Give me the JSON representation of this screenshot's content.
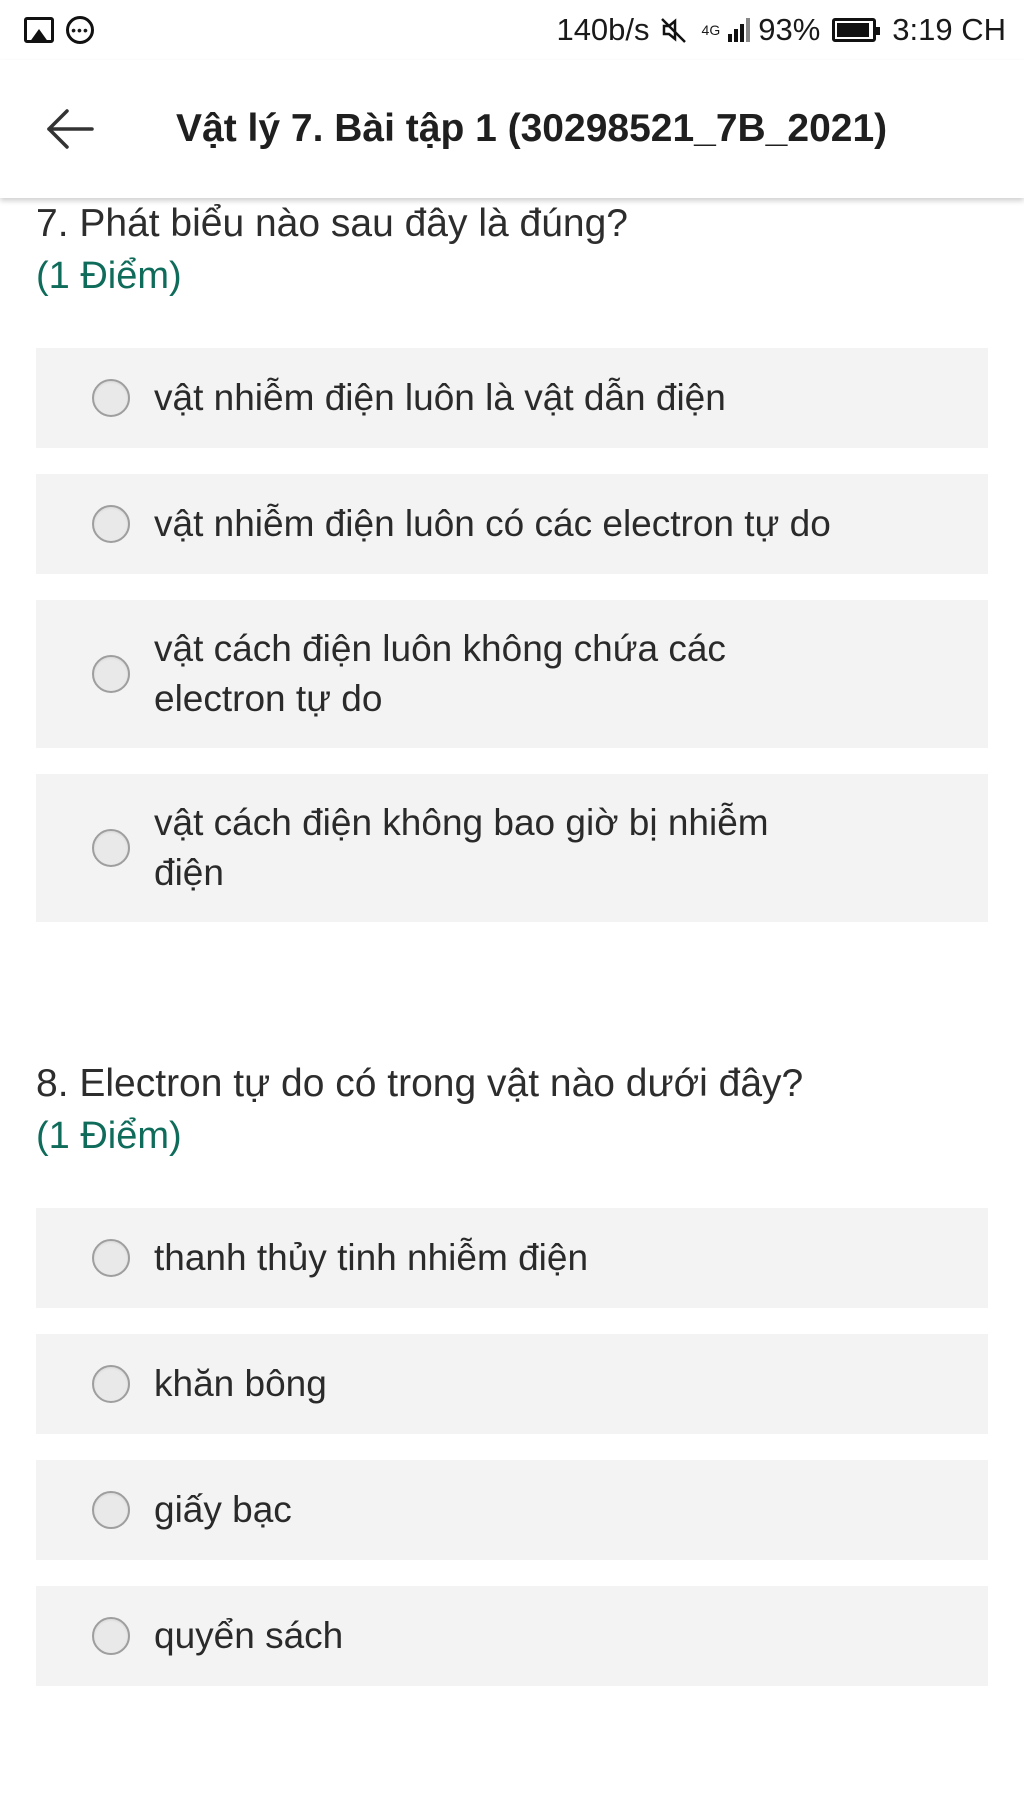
{
  "status_bar": {
    "speed": "140b/s",
    "network": "4G",
    "battery": "93%",
    "battery_level": 0.93,
    "time": "3:19 CH"
  },
  "app_bar": {
    "title": "Vật lý 7. Bài tập 1 (30298521_7B_2021)",
    "back_icon": "arrow-left-icon"
  },
  "questions": [
    {
      "title": "7. Phát biểu nào sau đây là đúng?",
      "points": "(1 Điểm)",
      "options": [
        "vật nhiễm điện luôn là vật dẫn điện",
        "vật nhiễm điện luôn có các electron tự do",
        "vật cách điện luôn không chứa các electron tự do",
        "vật cách điện không bao giờ bị nhiễm điện"
      ]
    },
    {
      "title": "8. Electron tự do có trong vật nào dưới đây?",
      "points": "(1 Điểm)",
      "options": [
        "thanh thủy tinh nhiễm điện",
        "khăn bông",
        "giấy bạc",
        "quyển sách"
      ]
    }
  ]
}
